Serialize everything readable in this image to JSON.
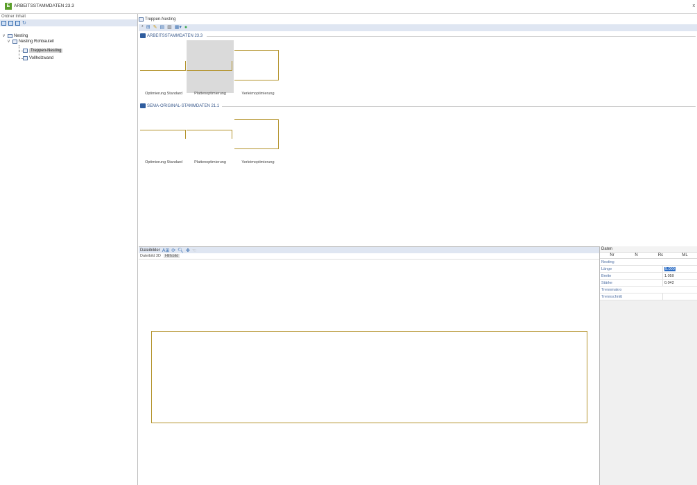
{
  "window": {
    "title": "ARBEITSSTAMMDATEN 23.3",
    "app_icon": "E",
    "close": "x"
  },
  "left_panel": {
    "header": "Ordner Inhalt",
    "tree": {
      "root": "Nesting",
      "child": "Nesting Rohbauteil",
      "items": [
        "Treppen-Nesting",
        "Vollholzwand"
      ]
    }
  },
  "right_panel": {
    "header": "Treppen-Nesting",
    "groups": [
      {
        "title": "ARBEITSSTAMMDATEN 23.3",
        "tiles": [
          "Optimierung Standard",
          "Plattenoptimierung",
          "Verleimoptimierung"
        ]
      },
      {
        "title": "SEMA-ORIGINAL-STAMMDATEN 21.1",
        "tiles": [
          "Optimierung Standard",
          "Plattenoptimierung",
          "Verleimoptimierung"
        ]
      }
    ]
  },
  "lower": {
    "toolbar_label": "Dateibilder",
    "tabs": [
      "Dateibild 3D",
      "Hilfsbild"
    ]
  },
  "properties": {
    "header": "Daten",
    "columns": [
      "Nr",
      "N",
      "Rc",
      "ML"
    ],
    "section": "Nesting",
    "rows": [
      {
        "key": "Länge",
        "value": "5.000"
      },
      {
        "key": "Breite",
        "value": "1.050"
      },
      {
        "key": "Stärke",
        "value": "0.042"
      }
    ],
    "section2": "Trennmakro",
    "row_last": {
      "key": "Trennschnitt",
      "value": ""
    }
  },
  "colors": {
    "accent": "#b3922a",
    "toolbar": "#dfe6f2",
    "selection": "#2b6cc4"
  }
}
